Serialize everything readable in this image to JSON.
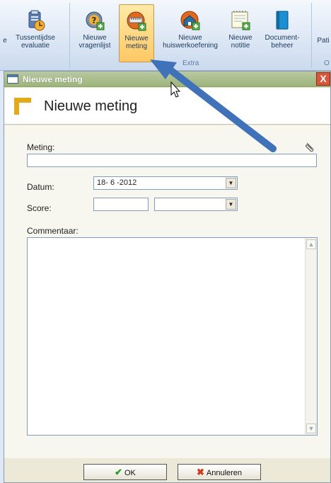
{
  "ribbon": {
    "buttons": [
      {
        "label": "e"
      },
      {
        "label": "Tussentijdse\nevaluatie"
      },
      {
        "label": "Nieuwe\nvragenlijst"
      },
      {
        "label": "Nieuwe\nmeting"
      },
      {
        "label": "Nieuwe\nhuiswerkoefening"
      },
      {
        "label": "Nieuwe\nnotitie"
      },
      {
        "label": "Document-\nbeheer"
      },
      {
        "label": "Pati"
      }
    ],
    "group_label": "Extra",
    "group_label_right": "O"
  },
  "dialog": {
    "title": "Nieuwe meting",
    "header_title": "Nieuwe meting",
    "close_label": "X"
  },
  "form": {
    "meting_label": "Meting:",
    "meting_value": "",
    "datum_label": "Datum:",
    "datum_value": "18- 6 -2012",
    "score_label": "Score:",
    "score_value": "",
    "score_unit_value": "",
    "commentaar_label": "Commentaar:",
    "commentaar_value": ""
  },
  "footer": {
    "ok_label": "OK",
    "cancel_label": "Annuleren"
  },
  "colors": {
    "ribbon_bg": "#dbe6f4",
    "active_btn": "#ffc864",
    "titlebar": "#9db47c",
    "arrow": "#3f72b8",
    "close": "#d9563b"
  },
  "icons": [
    "clipboard-clock-icon",
    "question-add-icon",
    "ruler-add-icon",
    "house-add-icon",
    "note-add-icon",
    "book-icon",
    "clip-icon",
    "checkmark-icon",
    "cross-icon",
    "window-icon",
    "corner-icon",
    "mouse-cursor-icon",
    "blue-arrow-icon"
  ]
}
